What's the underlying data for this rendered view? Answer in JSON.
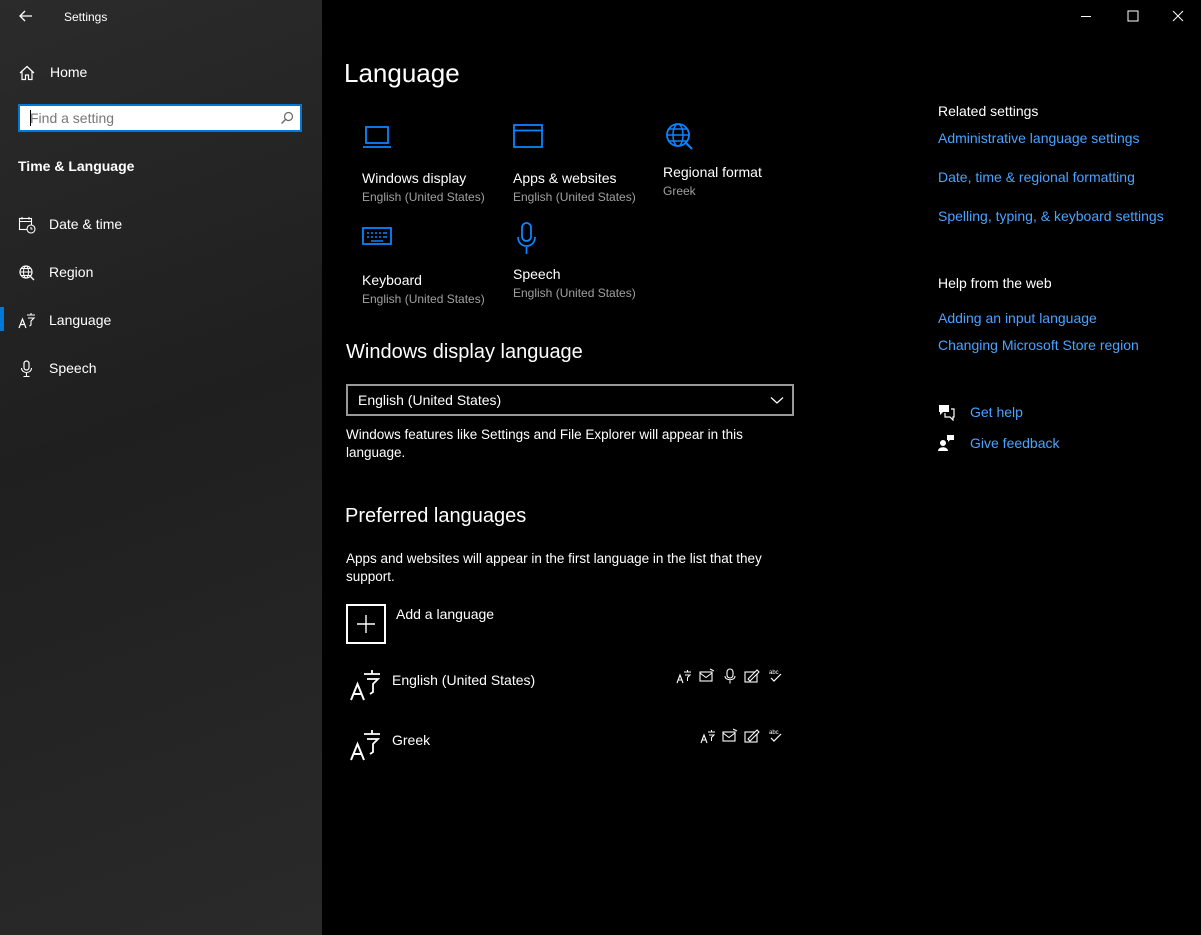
{
  "window": {
    "title": "Settings",
    "minimize_icon": "minimize-icon",
    "maximize_icon": "maximize-icon",
    "close_icon": "close-icon"
  },
  "sidebar": {
    "home_label": "Home",
    "search_placeholder": "Find a setting",
    "section_title": "Time & Language",
    "items": [
      {
        "label": "Date & time",
        "icon": "calendar-clock-icon"
      },
      {
        "label": "Region",
        "icon": "globe-icon"
      },
      {
        "label": "Language",
        "icon": "language-icon"
      },
      {
        "label": "Speech",
        "icon": "microphone-icon"
      }
    ],
    "active_item": "Language"
  },
  "main": {
    "page_title": "Language",
    "tiles": [
      {
        "title": "Windows display",
        "subtitle": "English (United States)",
        "icon": "laptop-icon"
      },
      {
        "title": "Apps & websites",
        "subtitle": "English (United States)",
        "icon": "window-icon"
      },
      {
        "title": "Regional format",
        "subtitle": "Greek",
        "icon": "globe-icon"
      },
      {
        "title": "Keyboard",
        "subtitle": "English (United States)",
        "icon": "keyboard-icon"
      },
      {
        "title": "Speech",
        "subtitle": "English (United States)",
        "icon": "microphone-icon"
      }
    ],
    "display_language": {
      "heading": "Windows display language",
      "selected": "English (United States)",
      "description_line1": "Windows features like Settings and File Explorer will appear in this",
      "description_line2": "language."
    },
    "preferred": {
      "heading": "Preferred languages",
      "description_line1": "Apps and websites will appear in the first language in the list that they",
      "description_line2": "support.",
      "add_label": "Add a language",
      "languages": [
        {
          "name": "English (United States)",
          "features": [
            "display-language-icon",
            "text-to-speech-icon",
            "speech-recognition-icon",
            "handwriting-icon",
            "spellcheck-icon"
          ]
        },
        {
          "name": "Greek",
          "features": [
            "display-language-icon",
            "text-to-speech-icon",
            "handwriting-icon",
            "spellcheck-icon"
          ]
        }
      ]
    }
  },
  "related": {
    "heading": "Related settings",
    "links": [
      "Administrative language settings",
      "Date, time & regional formatting",
      "Spelling, typing, & keyboard settings"
    ]
  },
  "help": {
    "heading": "Help from the web",
    "links": [
      "Adding an input language",
      "Changing Microsoft Store region"
    ],
    "get_help": "Get help",
    "give_feedback": "Give feedback"
  },
  "colors": {
    "accent": "#0078d7",
    "link": "#4aa3ff",
    "secondary_text": "#a0a0a0"
  }
}
